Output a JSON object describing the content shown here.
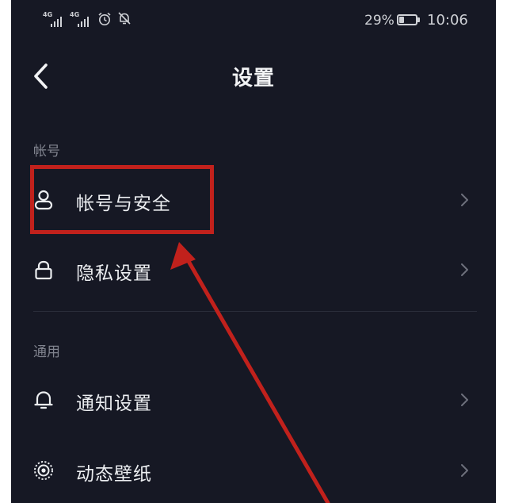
{
  "status_bar": {
    "network_1": "4G",
    "network_2": "4G",
    "battery_percent": "29%",
    "battery_level": 0.29,
    "time": "10:06",
    "icons": [
      "signal-icon",
      "signal-icon",
      "alarm-icon",
      "notification-muted-icon",
      "battery-icon"
    ]
  },
  "header": {
    "back_icon": "chevron-left-icon",
    "title": "设置"
  },
  "sections": [
    {
      "label": "帐号",
      "items": [
        {
          "label": "帐号与安全",
          "icon": "user-icon"
        },
        {
          "label": "隐私设置",
          "icon": "lock-icon"
        }
      ]
    },
    {
      "label": "通用",
      "items": [
        {
          "label": "通知设置",
          "icon": "bell-icon"
        },
        {
          "label": "动态壁纸",
          "icon": "live-wallpaper-icon"
        }
      ]
    }
  ],
  "annotation": {
    "highlight_color": "#c1211c",
    "highlighted_item": "帐号与安全"
  },
  "colors": {
    "background": "#161824",
    "text": "#eceef1",
    "section_text": "#80838e",
    "chevron": "#6d707c"
  }
}
